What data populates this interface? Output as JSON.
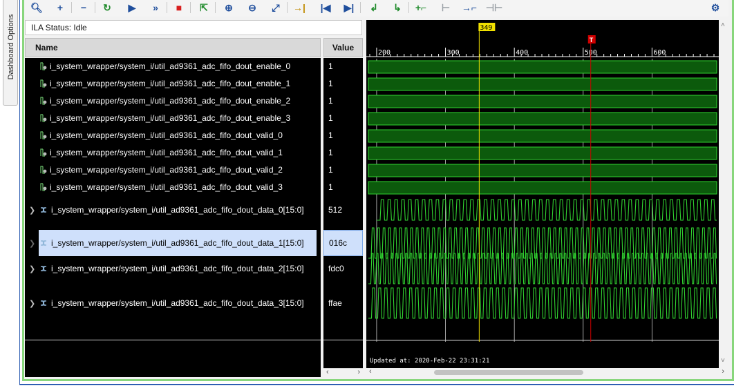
{
  "side_tab": {
    "label": "Dashboard Options"
  },
  "toolbar": {
    "buttons": [
      {
        "name": "zoom-fit-icon",
        "glyph": "🔍︎",
        "color": "#1f4e9c"
      },
      {
        "name": "add-probe-icon",
        "glyph": "+",
        "color": "#1f4e9c"
      },
      {
        "name": "remove-probe-icon",
        "glyph": "−",
        "color": "#1f4e9c"
      },
      {
        "name": "run-trigger-immediate-icon",
        "glyph": "↻",
        "color": "#1e8a2a"
      },
      {
        "name": "run-trigger-icon",
        "glyph": "▶",
        "color": "#1f4e9c"
      },
      {
        "name": "auto-retrigger-icon",
        "glyph": "»",
        "color": "#1f4e9c"
      },
      {
        "name": "stop-icon",
        "glyph": "■",
        "color": "#d81e1e"
      },
      {
        "name": "export-icon",
        "glyph": "⇱",
        "color": "#1e8a2a"
      },
      {
        "name": "zoom-in-icon",
        "glyph": "⊕",
        "color": "#1f4e9c"
      },
      {
        "name": "zoom-out-icon",
        "glyph": "⊖",
        "color": "#1f4e9c"
      },
      {
        "name": "zoom-full-icon",
        "glyph": "⤢",
        "color": "#1f4e9c"
      },
      {
        "name": "goto-cursor-icon",
        "glyph": "→|",
        "color": "#c08a00"
      },
      {
        "name": "goto-start-icon",
        "glyph": "|◀",
        "color": "#1f4e9c"
      },
      {
        "name": "goto-end-icon",
        "glyph": "▶|",
        "color": "#1f4e9c"
      },
      {
        "name": "previous-transition-icon",
        "glyph": "↲",
        "color": "#1e8a2a"
      },
      {
        "name": "next-transition-icon",
        "glyph": "↳",
        "color": "#1e8a2a"
      },
      {
        "name": "add-marker-icon",
        "glyph": "+⌐",
        "color": "#1e8a2a"
      },
      {
        "name": "previous-marker-icon",
        "glyph": "⊢",
        "color": "#9aa0a6"
      },
      {
        "name": "next-marker-icon",
        "glyph": "→⌐",
        "color": "#1f4e9c"
      },
      {
        "name": "swap-cursors-icon",
        "glyph": "⊣⊢",
        "color": "#9aa0a6"
      }
    ],
    "settings_icon": {
      "name": "gear-icon",
      "glyph": "⚙",
      "color": "#1f4e9c"
    }
  },
  "ila_status": "ILA Status: Idle",
  "columns": {
    "name": "Name",
    "value": "Value"
  },
  "signals": [
    {
      "name": "i_system_wrapper/system_i/util_ad9361_adc_fifo_dout_enable_0",
      "value": "1",
      "kind": "bit",
      "selected": false
    },
    {
      "name": "i_system_wrapper/system_i/util_ad9361_adc_fifo_dout_enable_1",
      "value": "1",
      "kind": "bit",
      "selected": false
    },
    {
      "name": "i_system_wrapper/system_i/util_ad9361_adc_fifo_dout_enable_2",
      "value": "1",
      "kind": "bit",
      "selected": false
    },
    {
      "name": "i_system_wrapper/system_i/util_ad9361_adc_fifo_dout_enable_3",
      "value": "1",
      "kind": "bit",
      "selected": false
    },
    {
      "name": "i_system_wrapper/system_i/util_ad9361_adc_fifo_dout_valid_0",
      "value": "1",
      "kind": "bit",
      "selected": false
    },
    {
      "name": "i_system_wrapper/system_i/util_ad9361_adc_fifo_dout_valid_1",
      "value": "1",
      "kind": "bit",
      "selected": false
    },
    {
      "name": "i_system_wrapper/system_i/util_ad9361_adc_fifo_dout_valid_2",
      "value": "1",
      "kind": "bit",
      "selected": false
    },
    {
      "name": "i_system_wrapper/system_i/util_ad9361_adc_fifo_dout_valid_3",
      "value": "1",
      "kind": "bit",
      "selected": false
    },
    {
      "name": "i_system_wrapper/system_i/util_ad9361_adc_fifo_dout_data_0[15:0]",
      "value": "512",
      "kind": "bus",
      "selected": false
    },
    {
      "name": "i_system_wrapper/system_i/util_ad9361_adc_fifo_dout_data_1[15:0]",
      "value": "016c",
      "kind": "bus",
      "selected": true
    },
    {
      "name": "i_system_wrapper/system_i/util_ad9361_adc_fifo_dout_data_2[15:0]",
      "value": "fdc0",
      "kind": "bus",
      "selected": false
    },
    {
      "name": "i_system_wrapper/system_i/util_ad9361_adc_fifo_dout_data_3[15:0]",
      "value": "ffae",
      "kind": "bus",
      "selected": false
    }
  ],
  "waveform": {
    "view_range": [
      185,
      697
    ],
    "major_ticks": [
      200,
      300,
      400,
      500,
      600
    ],
    "minor_step": 10,
    "cursor": {
      "label": "349",
      "sample": 349,
      "color": "#f0e000"
    },
    "trigger_marker": {
      "label": "T",
      "sample": 511,
      "color": "#d00000"
    },
    "bus_periods": [
      10,
      8,
      7,
      9
    ],
    "wave_color": "#31d431",
    "fill_color": "#0c5a0c",
    "updated": "Updated at: 2020-Feb-22 23:31:21"
  },
  "scroll": {
    "left": "‹",
    "right": "›",
    "up": "˄",
    "down": "˅"
  }
}
